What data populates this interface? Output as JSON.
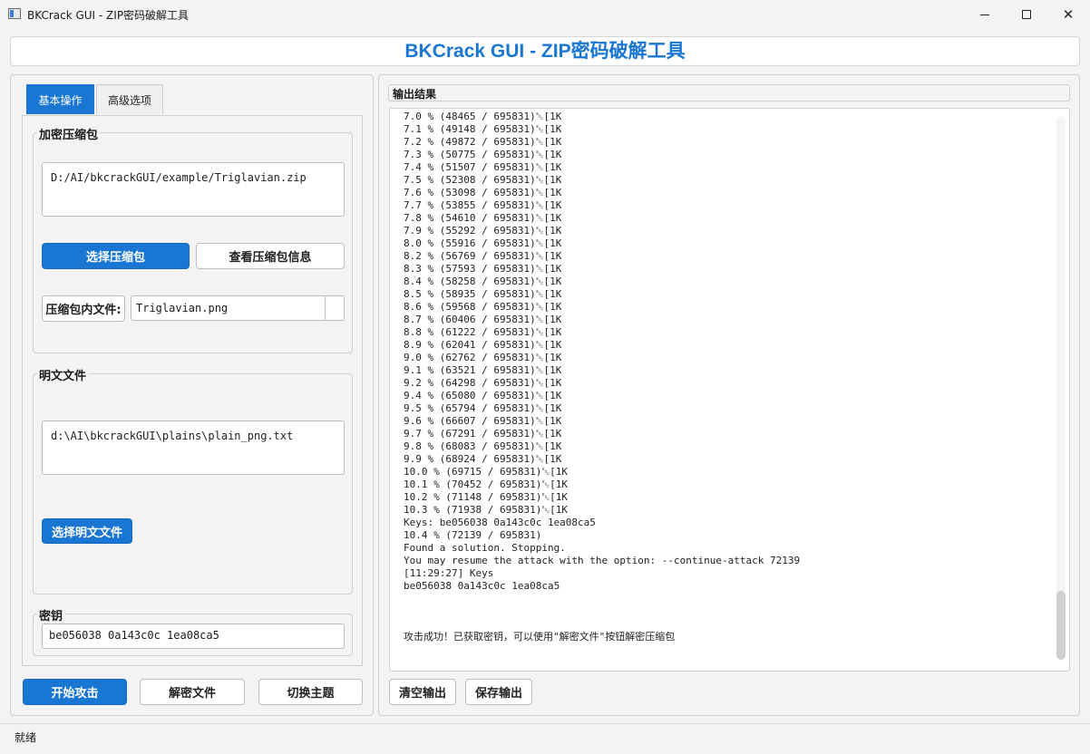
{
  "window": {
    "title": "BKCrack GUI - ZIP密码破解工具",
    "minimize": "",
    "maximize": "",
    "close": "✕"
  },
  "header": {
    "title": "BKCrack GUI - ZIP密码破解工具"
  },
  "tabs": [
    {
      "label": "基本操作",
      "active": true
    },
    {
      "label": "高级选项",
      "active": false
    }
  ],
  "zip_group": {
    "title": "加密压缩包",
    "path": "D:/AI/bkcrackGUI/example/Triglavian.zip",
    "select_button": "选择压缩包",
    "info_button": "查看压缩包信息",
    "inner_file_label": "压缩包内文件:",
    "inner_file_value": "Triglavian.png"
  },
  "plain_group": {
    "title": "明文文件",
    "path": "d:\\AI\\bkcrackGUI\\plains\\plain_png.txt",
    "select_button": "选择明文文件"
  },
  "key_group": {
    "title": "密钥",
    "value": "be056038 0a143c0c 1ea08ca5"
  },
  "bottom_buttons": {
    "start": "开始攻击",
    "decrypt": "解密文件",
    "theme": "切换主题"
  },
  "output": {
    "label": "输出结果",
    "lines": [
      "7.0 % (48465 / 695831)␛[1K",
      "7.1 % (49148 / 695831)␛[1K",
      "7.2 % (49872 / 695831)␛[1K",
      "7.3 % (50775 / 695831)␛[1K",
      "7.4 % (51507 / 695831)␛[1K",
      "7.5 % (52308 / 695831)␛[1K",
      "7.6 % (53098 / 695831)␛[1K",
      "7.7 % (53855 / 695831)␛[1K",
      "7.8 % (54610 / 695831)␛[1K",
      "7.9 % (55292 / 695831)␛[1K",
      "8.0 % (55916 / 695831)␛[1K",
      "8.2 % (56769 / 695831)␛[1K",
      "8.3 % (57593 / 695831)␛[1K",
      "8.4 % (58258 / 695831)␛[1K",
      "8.5 % (58935 / 695831)␛[1K",
      "8.6 % (59568 / 695831)␛[1K",
      "8.7 % (60406 / 695831)␛[1K",
      "8.8 % (61222 / 695831)␛[1K",
      "8.9 % (62041 / 695831)␛[1K",
      "9.0 % (62762 / 695831)␛[1K",
      "9.1 % (63521 / 695831)␛[1K",
      "9.2 % (64298 / 695831)␛[1K",
      "9.4 % (65080 / 695831)␛[1K",
      "9.5 % (65794 / 695831)␛[1K",
      "9.6 % (66607 / 695831)␛[1K",
      "9.7 % (67291 / 695831)␛[1K",
      "9.8 % (68083 / 695831)␛[1K",
      "9.9 % (68924 / 695831)␛[1K",
      "10.0 % (69715 / 695831)␛[1K",
      "10.1 % (70452 / 695831)␛[1K",
      "10.2 % (71148 / 695831)␛[1K",
      "10.3 % (71938 / 695831)␛[1K",
      "Keys: be056038 0a143c0c 1ea08ca5",
      "10.4 % (72139 / 695831)",
      "Found a solution. Stopping.",
      "You may resume the attack with the option: --continue-attack 72139",
      "[11:29:27] Keys",
      "be056038 0a143c0c 1ea08ca5",
      "",
      "",
      "",
      "攻击成功！已获取密钥，可以使用\"解密文件\"按钮解密压缩包"
    ],
    "clear_button": "清空输出",
    "save_button": "保存输出"
  },
  "status": {
    "text": "就绪"
  }
}
